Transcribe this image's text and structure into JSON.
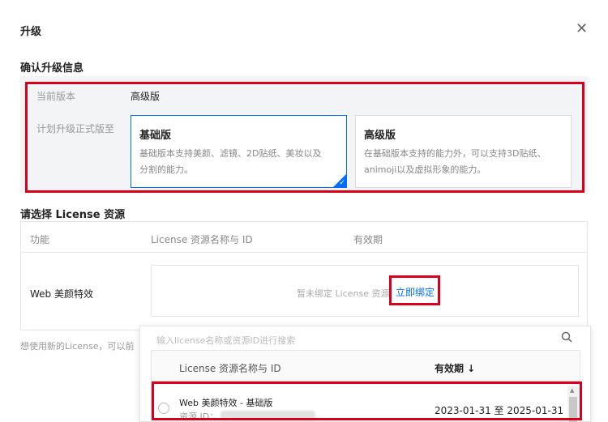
{
  "dialog": {
    "title": "升级",
    "close_icon": "close-icon"
  },
  "confirm_section": {
    "title": "确认升级信息",
    "current_version_label": "当前版本",
    "current_version_value": "高级版",
    "plan_label": "计划升级正式版至",
    "options": [
      {
        "title": "基础版",
        "desc_line1": "基础版本支持美颜、滤镜、2D贴纸、美妆以及",
        "desc_line2": "分割的能力。",
        "selected": true
      },
      {
        "title": "高级版",
        "desc_line1": "在基础版本支持的能力外，可以支持3D贴纸、",
        "desc_line2": "animoji以及虚拟形象的能力。",
        "selected": false
      }
    ]
  },
  "license_section": {
    "title": "请选择 License 资源",
    "columns": [
      "功能",
      "License 资源名称与 ID",
      "有效期"
    ],
    "row": {
      "feature": "Web 美颜特效",
      "unbound_text": "暂未绑定 License 资源",
      "bind_link": "立即绑定"
    },
    "hint": "想使用新的License，可以前"
  },
  "dropdown": {
    "search_placeholder": "输入license名称或资源ID进行搜索",
    "search_icon": "search-icon",
    "columns": [
      "License 资源名称与 ID",
      "有效期 ↓"
    ],
    "items": [
      {
        "name": "Web 美颜特效 - 基础版",
        "id_label": "资源 ID：",
        "validity": "2023-01-31 至 2025-01-31"
      }
    ]
  },
  "colors": {
    "accent": "#006eff",
    "highlight": "#d9001b"
  }
}
